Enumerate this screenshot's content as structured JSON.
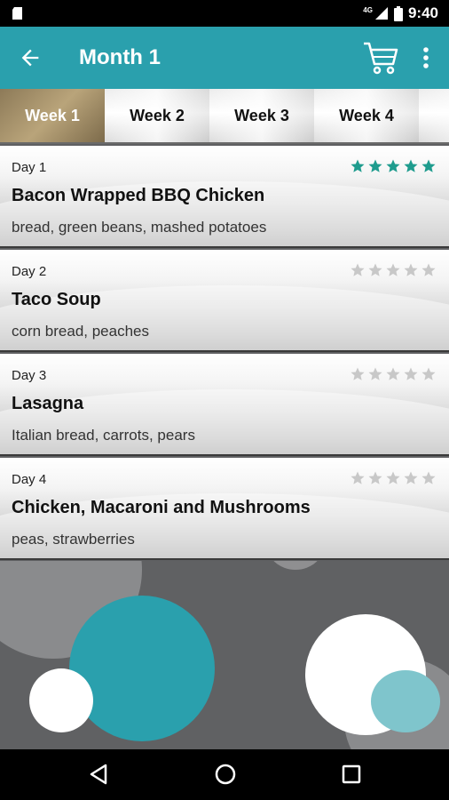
{
  "status_bar": {
    "time": "9:40",
    "network": "4G"
  },
  "app_bar": {
    "title": "Month 1"
  },
  "tabs": [
    "Week 1",
    "Week 2",
    "Week 3",
    "Week 4",
    "W"
  ],
  "meals": [
    {
      "day": "Day 1",
      "name": "Bacon Wrapped BBQ Chicken",
      "sides": "bread, green beans, mashed potatoes",
      "rating": 5
    },
    {
      "day": "Day 2",
      "name": "Taco Soup",
      "sides": "corn bread, peaches",
      "rating": 0
    },
    {
      "day": "Day 3",
      "name": "Lasagna",
      "sides": "Italian bread, carrots, pears",
      "rating": 0
    },
    {
      "day": "Day 4",
      "name": "Chicken, Macaroni and Mushrooms",
      "sides": "peas, strawberries",
      "rating": 0
    }
  ],
  "colors": {
    "accent": "#2aa0ad",
    "star_filled": "#1f9c8e",
    "star_empty": "#c8c8c8",
    "active_tab": "#9e8a64"
  }
}
